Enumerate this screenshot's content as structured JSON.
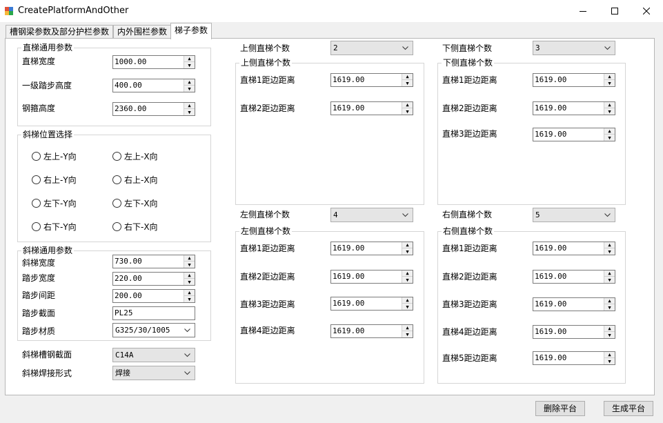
{
  "window": {
    "title": "CreatePlatformAndOther",
    "icon_colors": [
      "#e05038",
      "#3a7bd5",
      "#f6b93b",
      "#2aa84a"
    ]
  },
  "tabs": [
    {
      "label": "槽钢梁参数及部分护栏参数",
      "active": false
    },
    {
      "label": "内外围栏参数",
      "active": false
    },
    {
      "label": "梯子参数",
      "active": true
    }
  ],
  "straight_common": {
    "legend": "直梯通用参数",
    "fields": [
      {
        "label": "直梯宽度",
        "value": "1000.00"
      },
      {
        "label": "一级踏步高度",
        "value": "400.00"
      },
      {
        "label": "钢箍高度",
        "value": "2360.00"
      }
    ]
  },
  "incline_position": {
    "legend": "斜梯位置选择",
    "options": [
      "左上-Y向",
      "左上-X向",
      "右上-Y向",
      "右上-X向",
      "左下-Y向",
      "左下-X向",
      "右下-Y向",
      "右下-X向"
    ]
  },
  "incline_common": {
    "legend": "斜梯通用参数",
    "width": {
      "label": "斜梯宽度",
      "value": "730.00"
    },
    "step_width": {
      "label": "踏步宽度",
      "value": "220.00"
    },
    "step_spacing": {
      "label": "踏步间距",
      "value": "200.00"
    },
    "step_section": {
      "label": "踏步截面",
      "value": "PL25"
    },
    "step_material": {
      "label": "踏步材质",
      "value": "G325/30/1005"
    }
  },
  "channel_section": {
    "label": "斜梯槽钢截面",
    "value": "C14A"
  },
  "weld_type": {
    "label": "斜梯焊接形式",
    "value": "焊接"
  },
  "top": {
    "count_label": "上侧直梯个数",
    "count_value": "2",
    "legend": "上侧直梯个数",
    "rows": [
      {
        "label": "直梯1距边距离",
        "value": "1619.00"
      },
      {
        "label": "直梯2距边距离",
        "value": "1619.00"
      }
    ]
  },
  "bottom": {
    "count_label": "下侧直梯个数",
    "count_value": "3",
    "legend": "下侧直梯个数",
    "rows": [
      {
        "label": "直梯1距边距离",
        "value": "1619.00"
      },
      {
        "label": "直梯2距边距离",
        "value": "1619.00"
      },
      {
        "label": "直梯3距边距离",
        "value": "1619.00"
      }
    ]
  },
  "left": {
    "count_label": "左侧直梯个数",
    "count_value": "4",
    "legend": "左侧直梯个数",
    "rows": [
      {
        "label": "直梯1距边距离",
        "value": "1619.00"
      },
      {
        "label": "直梯2距边距离",
        "value": "1619.00"
      },
      {
        "label": "直梯3距边距离",
        "value": "1619.00"
      },
      {
        "label": "直梯4距边距离",
        "value": "1619.00"
      }
    ]
  },
  "right": {
    "count_label": "右侧直梯个数",
    "count_value": "5",
    "legend": "右侧直梯个数",
    "rows": [
      {
        "label": "直梯1距边距离",
        "value": "1619.00"
      },
      {
        "label": "直梯2距边距离",
        "value": "1619.00"
      },
      {
        "label": "直梯3距边距离",
        "value": "1619.00"
      },
      {
        "label": "直梯4距边距离",
        "value": "1619.00"
      },
      {
        "label": "直梯5距边距离",
        "value": "1619.00"
      }
    ]
  },
  "buttons": {
    "delete_label": "删除平台",
    "generate_label": "生成平台"
  }
}
